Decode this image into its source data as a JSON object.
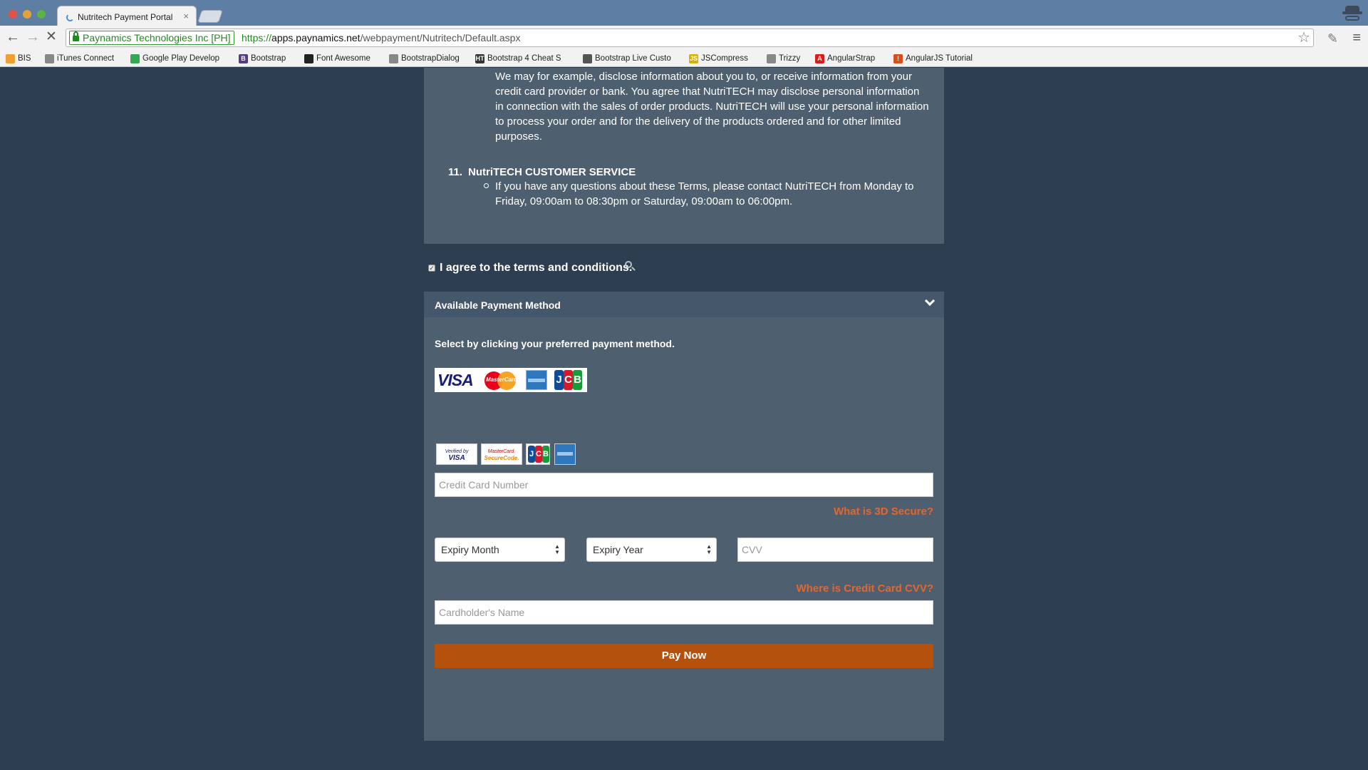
{
  "browser": {
    "tab_title": "Nutritech Payment Portal",
    "tab_close": "×",
    "ev_badge": "Paynamics Technologies Inc [PH]",
    "url_scheme": "https://",
    "url_host": "apps.paynamics.net",
    "url_path": "/webpayment/Nutritech/Default.aspx",
    "back_icon": "←",
    "forward_icon": "→",
    "stop_icon": "✕",
    "star_icon": "☆",
    "menu_icon": "≡",
    "ext_icon": "✎",
    "bookmarks": [
      {
        "label": "BIS",
        "icon": "rss-icon",
        "color": "#f0a030"
      },
      {
        "label": "iTunes Connect",
        "icon": "page-icon",
        "color": "#888888"
      },
      {
        "label": "Google Play Develop",
        "icon": "play-icon",
        "color": "#34a853"
      },
      {
        "label": "Bootstrap",
        "icon": "B",
        "color": "#563d7c"
      },
      {
        "label": "Font Awesome",
        "icon": "flag-icon",
        "color": "#222222"
      },
      {
        "label": "BootstrapDialog",
        "icon": "page-icon",
        "color": "#888888"
      },
      {
        "label": "Bootstrap 4 Cheat S",
        "icon": "HT",
        "color": "#333333"
      },
      {
        "label": "Bootstrap Live Custo",
        "icon": "gear-icon",
        "color": "#555555"
      },
      {
        "label": "JSCompress",
        "icon": "JS",
        "color": "#d4b106"
      },
      {
        "label": "Trizzy",
        "icon": "page-icon",
        "color": "#888888"
      },
      {
        "label": "AngularStrap",
        "icon": "A",
        "color": "#dd1b16"
      },
      {
        "label": "AngularJS Tutorial",
        "icon": "!",
        "color": "#dd4b16"
      }
    ]
  },
  "terms": {
    "p10_text": "collect, use and disclose your personal information in accordance with our Privacy Policy. We may for example, disclose information about you to, or receive information from your credit card provider or bank. You agree that NutriTECH may disclose personal information in connection with the sales of order products. NutriTECH will use your personal information to process your order and for the delivery of the products ordered and for other limited purposes.",
    "section11_number": "11.",
    "section11_title": "NutriTECH CUSTOMER SERVICE",
    "section11_text": "If you have any questions about these Terms, please contact NutriTECH from Monday to Friday, 09:00am to 08:30pm or Saturday, 09:00am to 06:00pm."
  },
  "agree": {
    "label": "I agree to the terms and conditions.",
    "checked": true
  },
  "payment": {
    "header": "Available Payment Method",
    "instructions": "Select by clicking your preferred payment method.",
    "visa_text": "VISA",
    "mastercard_text": "MasterCard",
    "vbv_top": "Verified by",
    "vbv_bottom": "VISA",
    "mcsc_top": "MasterCard.",
    "mcsc_bottom": "SecureCode.",
    "cc_placeholder": "Credit Card Number",
    "secure_link": "What is 3D Secure?",
    "expiry_month": "Expiry Month",
    "expiry_year": "Expiry Year",
    "cvv_placeholder": "CVV",
    "cvv_link": "Where is Credit Card CVV?",
    "name_placeholder": "Cardholder's Name",
    "pay_button": "Pay Now",
    "link_color": "#e5662d",
    "button_color": "#b4520d"
  }
}
